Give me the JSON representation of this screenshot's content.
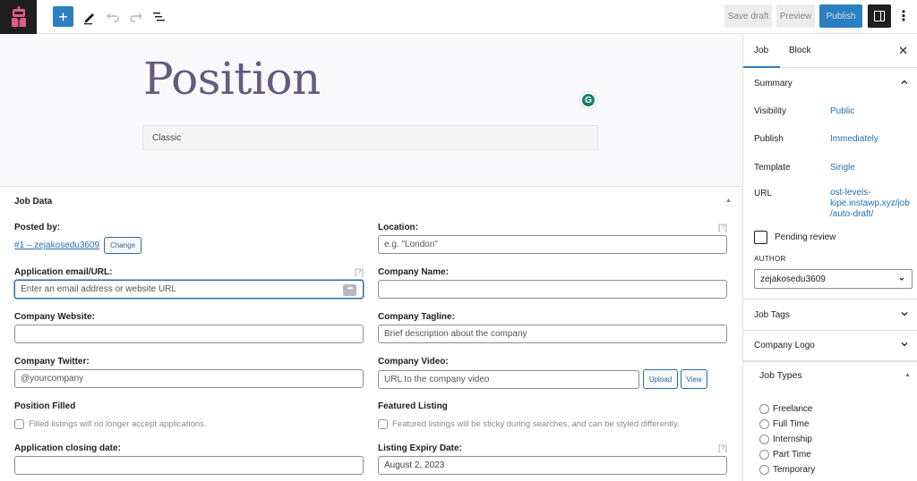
{
  "toolbar": {
    "logo_icon": "robot-logo-icon",
    "add_block": "+",
    "tools": [
      "pencil-icon",
      "undo-icon",
      "redo-icon",
      "list-view-icon"
    ],
    "save_draft": "Save draft",
    "preview": "Preview",
    "publish": "Publish",
    "more": "⋮"
  },
  "editor": {
    "title": "Position",
    "grammarly_glyph": "G",
    "classic_block": "Classic"
  },
  "job_data": {
    "title": "Job Data",
    "toggle": "▲",
    "help": "[?]",
    "posted_by": {
      "label": "Posted by:",
      "user_link": "#1 – zejakosedu3609",
      "change_button": "Change"
    },
    "application": {
      "label": "Application email/URL:",
      "placeholder": "Enter an email address or website URL",
      "dots": "•••"
    },
    "location": {
      "label": "Location:",
      "placeholder": "e.g. \"London\""
    },
    "company_name": {
      "label": "Company Name:",
      "value": ""
    },
    "company_website": {
      "label": "Company Website:",
      "value": ""
    },
    "company_tagline": {
      "label": "Company Tagline:",
      "placeholder": "Brief description about the company"
    },
    "company_twitter": {
      "label": "Company Twitter:",
      "placeholder": "@yourcompany"
    },
    "company_video": {
      "label": "Company Video:",
      "placeholder": "URL to the company video",
      "upload_button": "Upload",
      "view_button": "View"
    },
    "position_filled": {
      "label": "Position Filled",
      "checkbox_text": "Filled listings will no longer accept applications.",
      "checked": false
    },
    "featured_listing": {
      "label": "Featured Listing",
      "checkbox_text": "Featured listings will be sticky during searches, and can be styled differently.",
      "checked": false
    },
    "closing_date": {
      "label": "Application closing date:",
      "value": ""
    },
    "expiry_date": {
      "label": "Listing Expiry Date:",
      "value": "August 2, 2023"
    }
  },
  "sidebar": {
    "tabs": [
      {
        "label": "Job",
        "active": true
      },
      {
        "label": "Block",
        "active": false
      }
    ],
    "close": "✕",
    "summary": {
      "title": "Summary",
      "rows": [
        {
          "label": "Visibility",
          "value": "Public"
        },
        {
          "label": "Publish",
          "value": "Immediately"
        },
        {
          "label": "Template",
          "value": "Single"
        },
        {
          "label": "URL",
          "value": "ost-levels-kipe.instawp.xyz/job/auto-draft/",
          "lines": [
            "ost-levels-",
            "kipe.instawp.xyz/job",
            "/auto-draft/"
          ]
        }
      ],
      "pending_review": "Pending review",
      "author_label": "AUTHOR",
      "author_value": "zejakosedu3609"
    },
    "job_tags": "Job Tags",
    "company_logo": "Company Logo",
    "job_types": {
      "title": "Job Types",
      "toggle": "▲",
      "options": [
        "Freelance",
        "Full Time",
        "Internship",
        "Part Time",
        "Temporary"
      ]
    },
    "accent_color": "#2c7fc1",
    "link_color": "#2271b1"
  }
}
